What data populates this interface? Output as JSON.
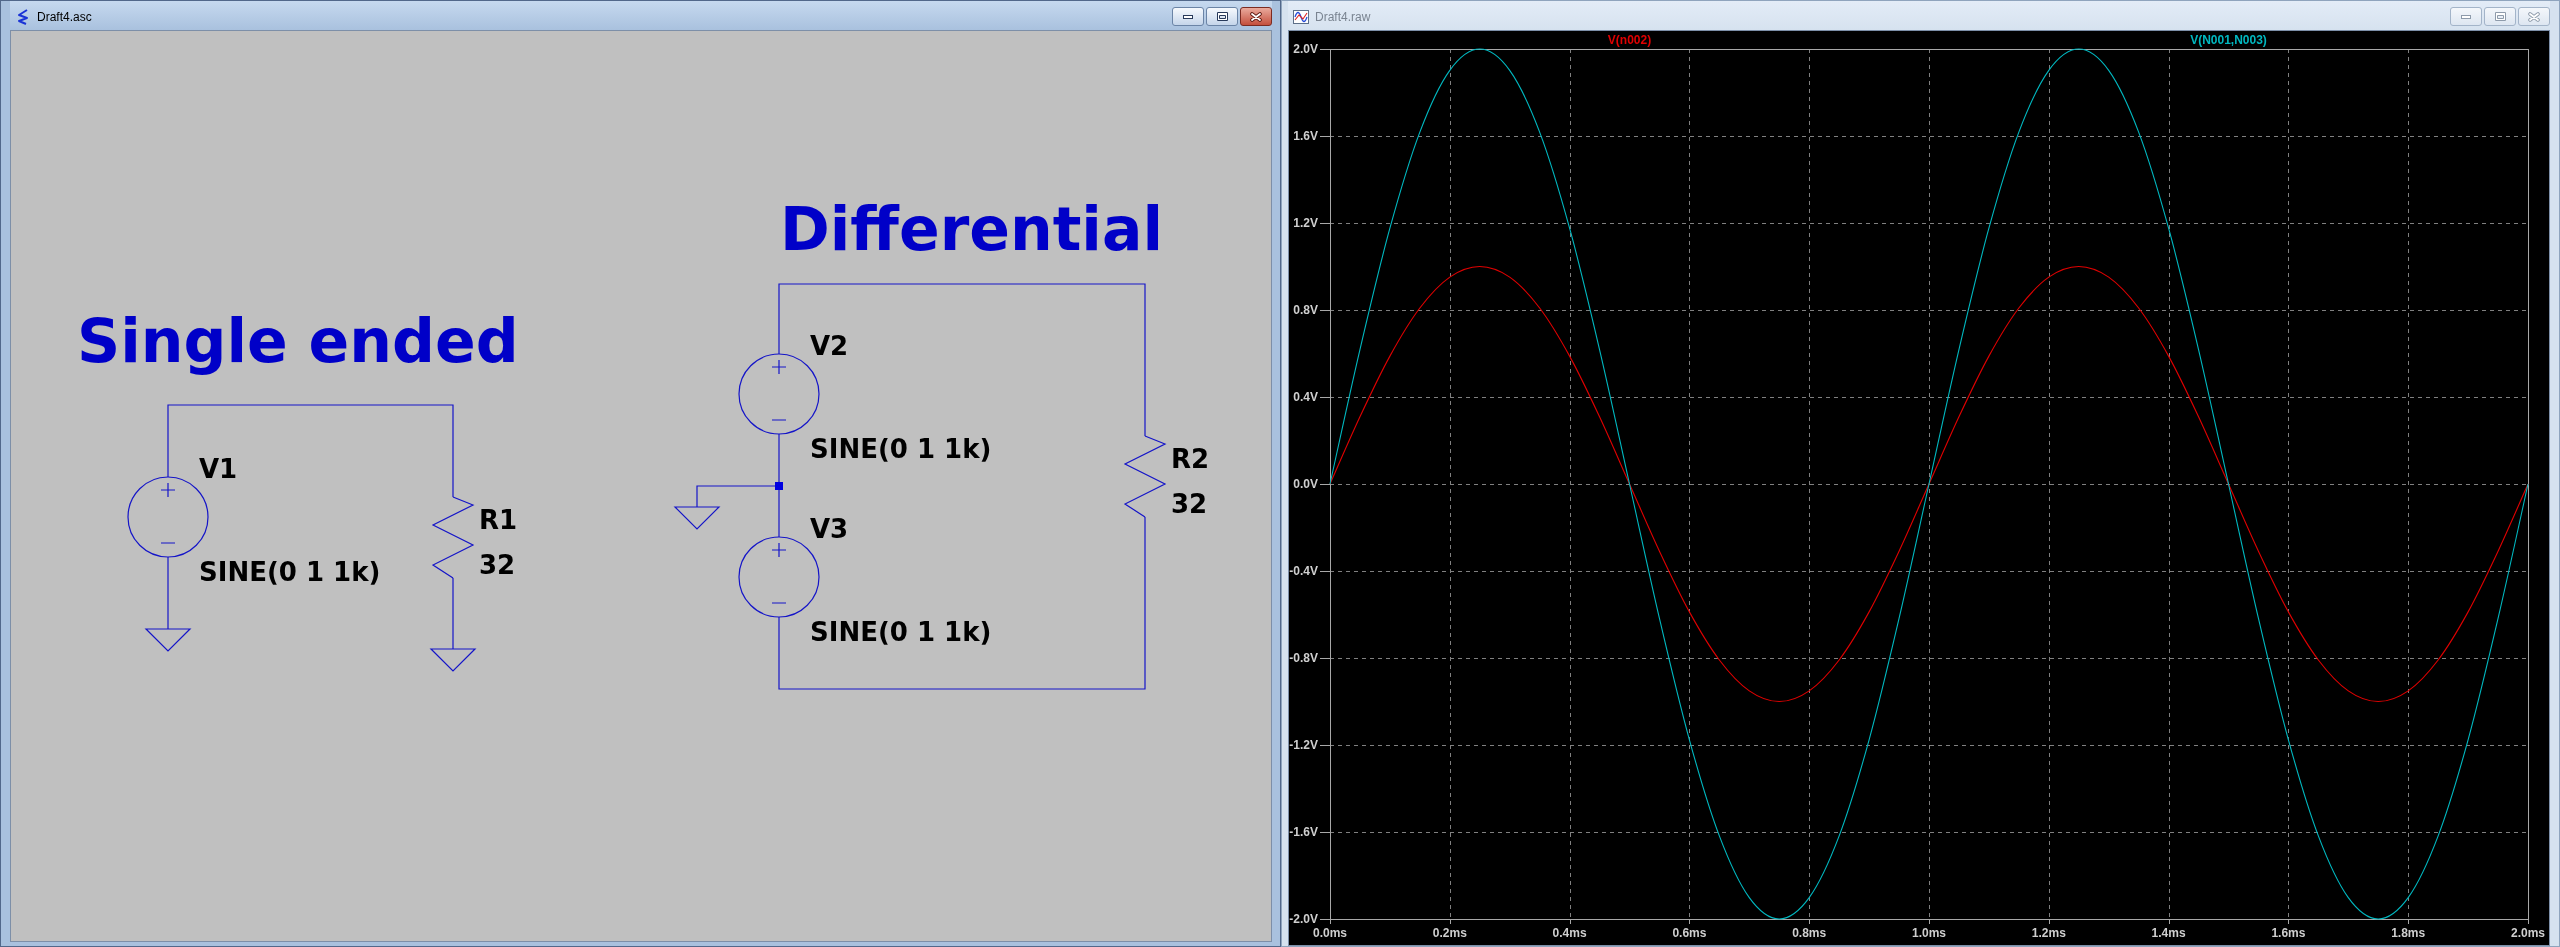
{
  "schematic_window": {
    "title": "Draft4.asc",
    "active": true,
    "sections": [
      {
        "heading": "Single ended",
        "components": [
          {
            "kind": "voltage_source",
            "name": "V1",
            "value": "SINE(0 1 1k)"
          },
          {
            "kind": "resistor",
            "name": "R1",
            "value": "32"
          }
        ]
      },
      {
        "heading": "Differential",
        "components": [
          {
            "kind": "voltage_source",
            "name": "V2",
            "value": "SINE(0 1 1k)"
          },
          {
            "kind": "voltage_source",
            "name": "V3",
            "value": "SINE(0 1 1k)"
          },
          {
            "kind": "resistor",
            "name": "R2",
            "value": "32"
          }
        ]
      }
    ]
  },
  "waveform_window": {
    "title": "Draft4.raw",
    "active": false,
    "chart_data": {
      "type": "line",
      "grid": true,
      "xlim": [
        0,
        2
      ],
      "ylim": [
        -2,
        2
      ],
      "xticks": [
        {
          "value": 0,
          "label": "0.0ms"
        },
        {
          "value": 0.2,
          "label": "0.2ms"
        },
        {
          "value": 0.4,
          "label": "0.4ms"
        },
        {
          "value": 0.6,
          "label": "0.6ms"
        },
        {
          "value": 0.8,
          "label": "0.8ms"
        },
        {
          "value": 1,
          "label": "1.0ms"
        },
        {
          "value": 1.2,
          "label": "1.2ms"
        },
        {
          "value": 1.4,
          "label": "1.4ms"
        },
        {
          "value": 1.6,
          "label": "1.6ms"
        },
        {
          "value": 1.8,
          "label": "1.8ms"
        },
        {
          "value": 2,
          "label": "2.0ms"
        }
      ],
      "yticks": [
        {
          "value": -2,
          "label": "-2.0V"
        },
        {
          "value": -1.6,
          "label": "-1.6V"
        },
        {
          "value": -1.2,
          "label": "-1.2V"
        },
        {
          "value": -0.8,
          "label": "-0.8V"
        },
        {
          "value": -0.4,
          "label": "-0.4V"
        },
        {
          "value": 0,
          "label": "0.0V"
        },
        {
          "value": 0.4,
          "label": "0.4V"
        },
        {
          "value": 0.8,
          "label": "0.8V"
        },
        {
          "value": 1.2,
          "label": "1.2V"
        },
        {
          "value": 1.6,
          "label": "1.6V"
        },
        {
          "value": 2,
          "label": "2.0V"
        }
      ],
      "x": [
        0,
        0.05,
        0.1,
        0.15,
        0.2,
        0.25,
        0.3,
        0.35,
        0.4,
        0.45,
        0.5,
        0.55,
        0.6,
        0.65,
        0.7,
        0.75,
        0.8,
        0.85,
        0.9,
        0.95,
        1,
        1.05,
        1.1,
        1.15,
        1.2,
        1.25,
        1.3,
        1.35,
        1.4,
        1.45,
        1.5,
        1.55,
        1.6,
        1.65,
        1.7,
        1.75,
        1.8,
        1.85,
        1.9,
        1.95,
        2
      ],
      "series": [
        {
          "name": "V(n002)",
          "color": "#e00000",
          "values": [
            0,
            0.309,
            0.588,
            0.809,
            0.951,
            1,
            0.951,
            0.809,
            0.588,
            0.309,
            0,
            -0.309,
            -0.588,
            -0.809,
            -0.951,
            -1,
            -0.951,
            -0.809,
            -0.588,
            -0.309,
            0,
            0.309,
            0.588,
            0.809,
            0.951,
            1,
            0.951,
            0.809,
            0.588,
            0.309,
            0,
            -0.309,
            -0.588,
            -0.809,
            -0.951,
            -1,
            -0.951,
            -0.809,
            -0.588,
            -0.309,
            0
          ]
        },
        {
          "name": "V(N001,N003)",
          "color": "#00b8c0",
          "values": [
            0,
            0.618,
            1.176,
            1.618,
            1.902,
            2,
            1.902,
            1.618,
            1.176,
            0.618,
            0,
            -0.618,
            -1.176,
            -1.618,
            -1.902,
            -2,
            -1.902,
            -1.618,
            -1.176,
            -0.618,
            0,
            0.618,
            1.176,
            1.618,
            1.902,
            2,
            1.902,
            1.618,
            1.176,
            0.618,
            0,
            -0.618,
            -1.176,
            -1.618,
            -1.902,
            -2,
            -1.902,
            -1.618,
            -1.176,
            -0.618,
            0
          ]
        }
      ]
    }
  }
}
